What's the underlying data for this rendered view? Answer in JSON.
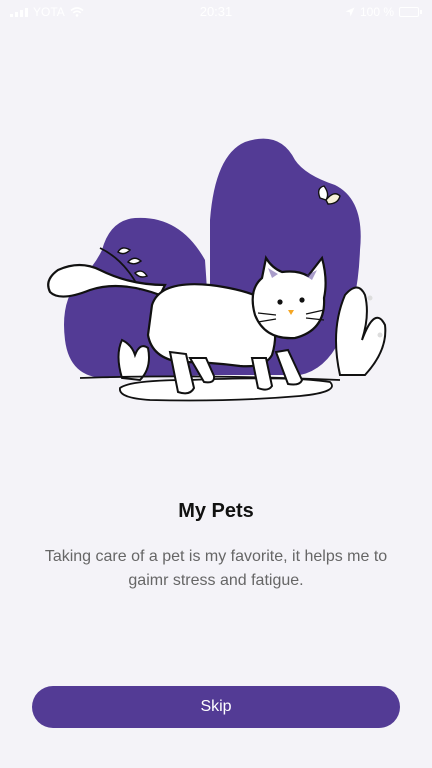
{
  "status_bar": {
    "carrier": "YOTA",
    "time": "20:31",
    "battery_percent": "100 %",
    "battery_level": 1.0
  },
  "onboarding": {
    "title": "My Pets",
    "description": "Taking care of a pet is my favorite, it helps me to gaimr stress and fatigue.",
    "skip_label": "Skip"
  },
  "colors": {
    "accent": "#533b95",
    "background": "#f4f3f8",
    "text_primary": "#111111",
    "text_secondary": "#666666"
  },
  "icons": {
    "illustration": "cat-illustration",
    "wifi": "wifi-icon",
    "location": "location-arrow-icon",
    "battery": "battery-icon"
  }
}
